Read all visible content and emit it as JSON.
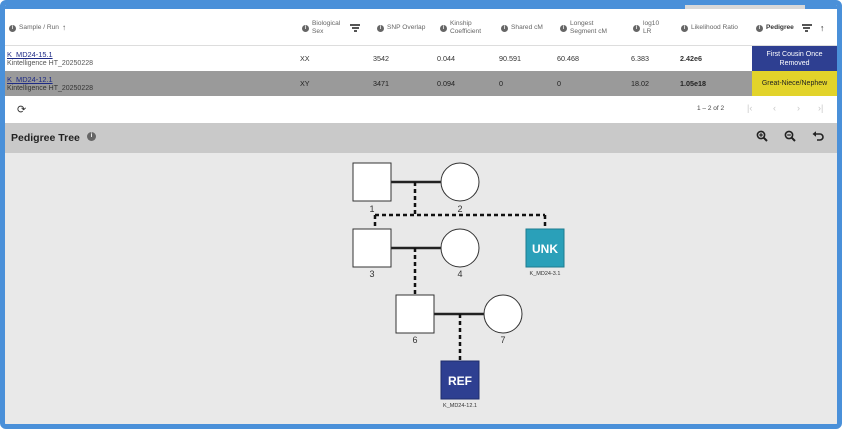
{
  "table": {
    "headers": {
      "sample": "Sample / Run",
      "sex_line1": "Biological",
      "sex_line2": "Sex",
      "snp": "SNP Overlap",
      "kinship_line1": "Kinship",
      "kinship_line2": "Coefficient",
      "shared": "Shared cM",
      "longest_line1": "Longest",
      "longest_line2": "Segment cM",
      "log_line1": "log10",
      "log_line2": "LR",
      "likelihood": "Likelihood Ratio",
      "pedigree": "Pedigree"
    },
    "rows": [
      {
        "sample": "K_MD24-15.1",
        "run": "Kintelligence HT_20250228",
        "sex": "XX",
        "snp": "3542",
        "kinship": "0.044",
        "shared": "90.591",
        "longest": "60.468",
        "log_lr": "6.383",
        "lr": "2.42e6",
        "pedigree_line1": "First Cousin Once",
        "pedigree_line2": "Removed",
        "pedigree_color": "#2e3f91"
      },
      {
        "sample": "K_MD24-12.1",
        "run": "Kintelligence HT_20250228",
        "sex": "XY",
        "snp": "3471",
        "kinship": "0.094",
        "shared": "0",
        "longest": "0",
        "log_lr": "18.02",
        "lr": "1.05e18",
        "pedigree_line1": "Great-Niece/Nephew",
        "pedigree_line2": "",
        "pedigree_color": "#e2d32a"
      }
    ]
  },
  "pager": {
    "text": "1 – 2 of 2",
    "icons": [
      "refresh-icon",
      "first-page-icon",
      "prev-page-icon",
      "next-page-icon",
      "last-page-icon"
    ]
  },
  "pedigree": {
    "title": "Pedigree Tree",
    "tools": [
      "zoom-in-icon",
      "zoom-out-icon",
      "undo-icon"
    ],
    "nodes": {
      "n1": "1",
      "n2": "2",
      "n3": "3",
      "n4": "4",
      "n6": "6",
      "n7": "7",
      "unk": "UNK",
      "unk_caption": "K_MD24-3.1",
      "ref": "REF",
      "ref_caption": "K_MD24-12.1"
    },
    "colors": {
      "unk": "#2aa0b9",
      "ref": "#2e3f91"
    }
  }
}
